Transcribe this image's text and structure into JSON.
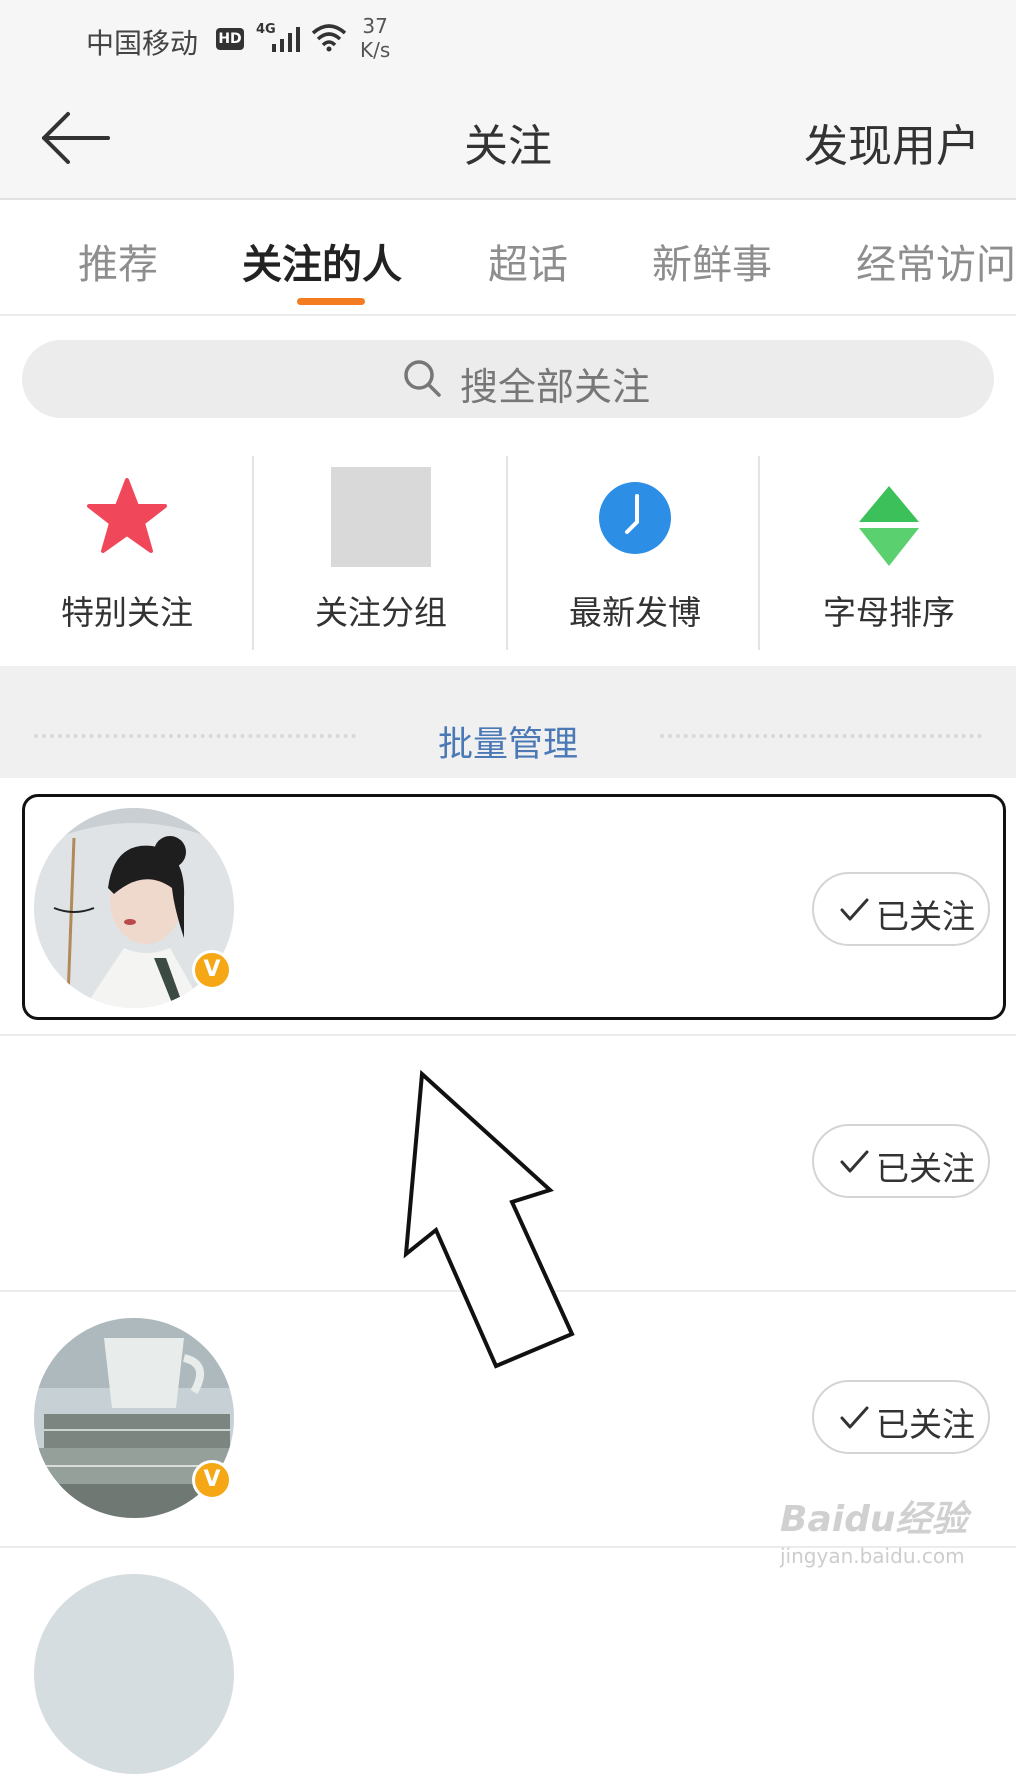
{
  "status_bar": {
    "carrier": "中国移动",
    "hd": "HD",
    "network": "4G",
    "speed_value": "37",
    "speed_unit": "K/s"
  },
  "nav": {
    "title": "关注",
    "right_action": "发现用户"
  },
  "tabs": [
    {
      "label": "推荐",
      "active": false
    },
    {
      "label": "关注的人",
      "active": true
    },
    {
      "label": "超话",
      "active": false
    },
    {
      "label": "新鲜事",
      "active": false
    },
    {
      "label": "经常访问",
      "active": false
    }
  ],
  "search": {
    "placeholder": "搜全部关注"
  },
  "shortcuts": [
    {
      "label": "特别关注",
      "icon": "star-icon",
      "color": "#f0475a"
    },
    {
      "label": "关注分组",
      "icon": "group-placeholder-icon",
      "color": "#d9d9d9"
    },
    {
      "label": "最新发博",
      "icon": "clock-icon",
      "color": "#2d8ee6"
    },
    {
      "label": "字母排序",
      "icon": "sort-icon",
      "color": "#3cc05a"
    }
  ],
  "batch": {
    "label": "批量管理"
  },
  "follow_list": [
    {
      "button": "已关注",
      "verified": true,
      "avatar": "avatar-girl-umbrella"
    },
    {
      "button": "已关注",
      "verified": false,
      "avatar": ""
    },
    {
      "button": "已关注",
      "verified": true,
      "avatar": "avatar-cup-books"
    }
  ],
  "verified_badge": "V",
  "watermark": {
    "logo": "Baidu经验",
    "url": "jingyan.baidu.com"
  },
  "colors": {
    "accent": "#f47b20",
    "link": "#4a79b5",
    "verified": "#f5a716"
  }
}
